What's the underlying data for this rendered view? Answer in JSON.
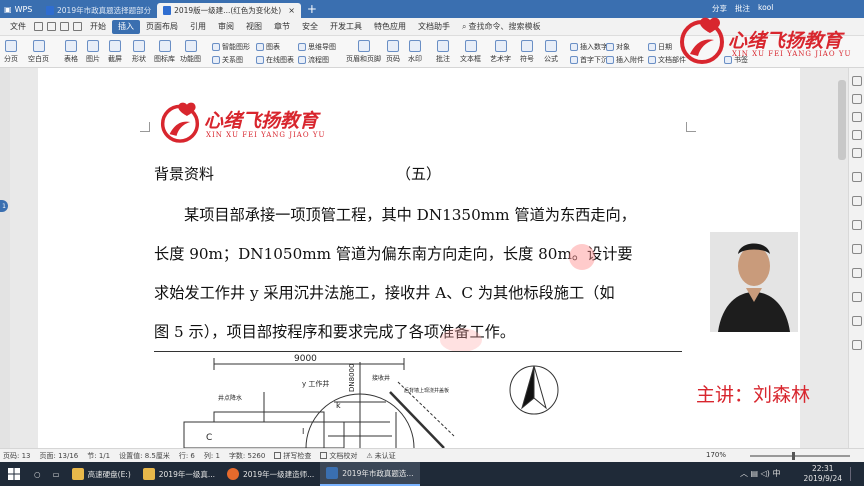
{
  "titlebar": {
    "app": "WPS",
    "tabs": [
      {
        "label": "2019年市政真题选择题部分",
        "active": false
      },
      {
        "label": "2019版一级建...(红色为变化处)",
        "active": true
      }
    ],
    "right_items": [
      "分享",
      "批注",
      "kool"
    ]
  },
  "menubar": {
    "file": "文件",
    "items": [
      "开始",
      "插入",
      "页面布局",
      "引用",
      "审阅",
      "视图",
      "章节",
      "安全",
      "开发工具",
      "特色应用",
      "文档助手"
    ],
    "active": "插入",
    "search": "查找命令、搜索模板"
  },
  "toolbar": {
    "items": [
      "分页",
      "空白页",
      "表格",
      "图片",
      "截屏",
      "形状",
      "图标库",
      "功能图",
      "智能图形",
      "关系图",
      "图表",
      "在线图表",
      "思维导图",
      "流程图",
      "页眉和页脚",
      "页码",
      "水印",
      "批注",
      "文本框",
      "艺术字",
      "符号",
      "公式",
      "首字下沉",
      "插入数字",
      "对象",
      "插入附件",
      "日期",
      "文档部件",
      "书签"
    ]
  },
  "logo": {
    "brand": "心绪飞扬教育",
    "pinyin": "XIN XU FEI YANG JIAO YU"
  },
  "document": {
    "heading": "背景资料",
    "section": "（五）",
    "lines": [
      "某项目部承接一项顶管工程，其中 DN1350mm 管道为东西走向，",
      "长度 90m；DN1050mm 管道为偏东南方向走向，长度 80m。设计要",
      "求始发工作井 y 采用沉井法施工，接收井 A、C 为其他标段施工（如",
      "图 5 示），项目部按程序和要求完成了各项准备工作。"
    ],
    "drawing_labels": {
      "dim": "9000",
      "pipe": "DN8000",
      "y": "y 工作井",
      "a": "井点降水",
      "b": "接收井",
      "c": "C",
      "note": "后背墙上现浇井盖板",
      "k": "k",
      "i": "I"
    }
  },
  "presenter": "主讲：刘森林",
  "statusbar": {
    "page": "页码: 13",
    "pages": "页面: 13/16",
    "section": "节: 1/1",
    "setting": "设置值: 8.5厘米",
    "row": "行: 6",
    "col": "列: 1",
    "words": "字数: 5260",
    "spell": "拼写检查",
    "proof": "文档校对",
    "auth": "未认证",
    "zoom": "170%"
  },
  "taskbar": {
    "items": [
      {
        "label": "高速硬盘(E:)",
        "color": "#e8b84a"
      },
      {
        "label": "2019年一级真...",
        "color": "#e8b84a"
      },
      {
        "label": "2019年一级建造师...",
        "color": "#e66a2c"
      },
      {
        "label": "2019年市政真题选...",
        "color": "#3a6fb0"
      }
    ],
    "time": "22:31",
    "date": "2019/9/24",
    "ime": "中"
  }
}
